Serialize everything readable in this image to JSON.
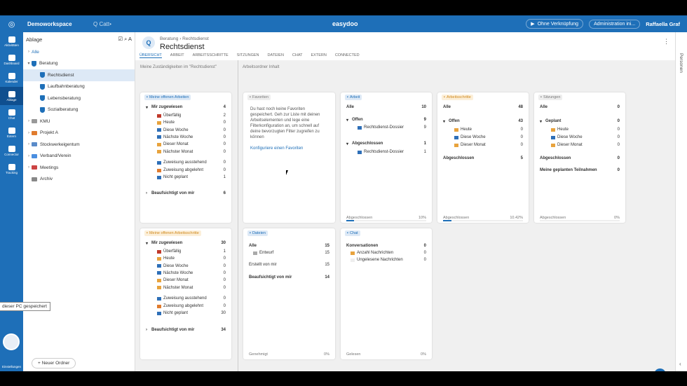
{
  "topbar": {
    "workspace": "Demoworkspace",
    "search_placeholder": "Q Catt•",
    "brand": "easydoo",
    "link_label": "Ohne Verknüpfung",
    "admin_label": "Administration ini...",
    "user": "Raffaella Graf"
  },
  "leftnav": [
    "Aktivitäten",
    "Dashboard",
    "Kalender",
    "Ablage",
    "Chat",
    "Extern",
    "Connector",
    "Tracking"
  ],
  "leftnav_settings": "Einstellungen",
  "tooltip": "dieser PC gespeichert",
  "tree": {
    "title": "Ablage",
    "all": "Alle",
    "items": [
      {
        "label": "Beratung",
        "level": 0,
        "icon": "shield",
        "chev": "▾"
      },
      {
        "label": "Rechtsdienst",
        "level": 1,
        "icon": "shield",
        "selected": true
      },
      {
        "label": "Laufbahnberatung",
        "level": 1,
        "icon": "shield"
      },
      {
        "label": "Lebensberatung",
        "level": 1,
        "icon": "shield"
      },
      {
        "label": "Sozialberatung",
        "level": 1,
        "icon": "shield"
      },
      {
        "label": "KMU",
        "level": 0,
        "icon": "folder",
        "chev": "›"
      },
      {
        "label": "Projekt A",
        "level": 0,
        "icon": "folder",
        "chev": "›"
      },
      {
        "label": "Stockwerkeigentum",
        "level": 0,
        "icon": "folder",
        "chev": "›"
      },
      {
        "label": "Verband/Verein",
        "level": 0,
        "icon": "folder",
        "chev": "›"
      },
      {
        "label": "Meetings",
        "level": 0,
        "icon": "folder",
        "chev": "›"
      },
      {
        "label": "Archiv",
        "level": 0,
        "icon": "folder",
        "chev": ""
      }
    ],
    "new_folder": "+ Neuer Ordner"
  },
  "header": {
    "crumb1": "Beratung",
    "crumb2": "Rechtsdienst",
    "title": "Rechtsdienst",
    "tabs": [
      "ÜBERSICHT",
      "ARBEIT",
      "ARBEITSSCHRITTE",
      "SITZUNGEN",
      "DATEIEN",
      "CHAT",
      "EXTERN",
      "CONNECTED"
    ]
  },
  "rightrail": "Personen",
  "bar": {
    "left": "Meine Zuständigkeiten im \"Rechtsdienst\"",
    "right": "Arbeitsordner Inhalt"
  },
  "cards": {
    "open_work": {
      "title": "Meine offenen Arbeiten",
      "rows": [
        [
          "Mir zugewiesen",
          "4"
        ],
        [
          "Überfällig",
          "2"
        ],
        [
          "Heute",
          "0"
        ],
        [
          "Diese Woche",
          "0"
        ],
        [
          "Nächste Woche",
          "0"
        ],
        [
          "Dieser Monat",
          "0"
        ],
        [
          "Nächster Monat",
          "0"
        ],
        [
          "Zuweisung ausstehend",
          "0"
        ],
        [
          "Zuweisung abgelehnt",
          "0"
        ],
        [
          "Nicht geplant",
          "1"
        ],
        [
          "Beaufsichtigt von mir",
          "6"
        ]
      ]
    },
    "favorites": {
      "title": "Favoriten",
      "text": "Du hast noch keine Favoriten gespeichert. Geh zur Liste mit deinen Arbeitselementen und lege eine Filterkonfiguration an, um schnell auf deine bevorzugten Filter zugreifen zu können",
      "link": "Konfiguriere einen Favoriten"
    },
    "work": {
      "title": "Arbeit",
      "rows": [
        [
          "Alle",
          "10"
        ],
        [
          "Offen",
          "9"
        ],
        [
          "Rechtsdienst-Dossier",
          "9"
        ],
        [
          "Abgeschlossen",
          "1"
        ],
        [
          "Rechtsdienst-Dossier",
          "1"
        ]
      ],
      "foot_l": "Abgeschlossen",
      "foot_r": "10%",
      "progress": 0.1
    },
    "steps": {
      "title": "Arbeitsschritte",
      "rows": [
        [
          "Alle",
          "48"
        ],
        [
          "Offen",
          "43"
        ],
        [
          "Heute",
          "0"
        ],
        [
          "Diese Woche",
          "0"
        ],
        [
          "Dieser Monat",
          "0"
        ],
        [
          "Abgeschlossen",
          "5"
        ]
      ],
      "foot_l": "Abgeschlossen",
      "foot_r": "10.42%",
      "progress": 0.1042
    },
    "meetings": {
      "title": "Sitzungen",
      "rows": [
        [
          "Alle",
          "0"
        ],
        [
          "Geplant",
          "0"
        ],
        [
          "Heute",
          "0"
        ],
        [
          "Diese Woche",
          "0"
        ],
        [
          "Dieser Monat",
          "0"
        ],
        [
          "Abgeschlossen",
          "0"
        ],
        [
          "Meine geplanten Teilnahmen",
          "0"
        ]
      ],
      "foot_l": "Abgeschlossen",
      "foot_r": "0%",
      "progress": 0
    },
    "open_steps": {
      "title": "Meine offenen Arbeitsschritte",
      "rows": [
        [
          "Mir zugewiesen",
          "30"
        ],
        [
          "Überfällig",
          "1"
        ],
        [
          "Heute",
          "0"
        ],
        [
          "Diese Woche",
          "0"
        ],
        [
          "Nächste Woche",
          "0"
        ],
        [
          "Dieser Monat",
          "0"
        ],
        [
          "Nächster Monat",
          "0"
        ],
        [
          "Zuweisung ausstehend",
          "0"
        ],
        [
          "Zuweisung abgelehnt",
          "0"
        ],
        [
          "Nicht geplant",
          "30"
        ],
        [
          "Beaufsichtigt von mir",
          "34"
        ]
      ]
    },
    "docs": {
      "title": "Dateien",
      "rows": [
        [
          "Alle",
          "15"
        ],
        [
          "Entwurf",
          "15"
        ],
        [
          "Erstellt von mir",
          "15"
        ],
        [
          "Beaufsichtigt von mir",
          "14"
        ]
      ],
      "foot_l": "Genehmigt",
      "foot_r": "0%"
    },
    "chat": {
      "title": "Chat",
      "rows": [
        [
          "Konversationen",
          "0"
        ],
        [
          "Anzahl Nachrichten",
          "0"
        ],
        [
          "Ungelesene Nachrichten",
          "0"
        ]
      ],
      "foot_l": "Gelesen",
      "foot_r": "0%"
    }
  }
}
